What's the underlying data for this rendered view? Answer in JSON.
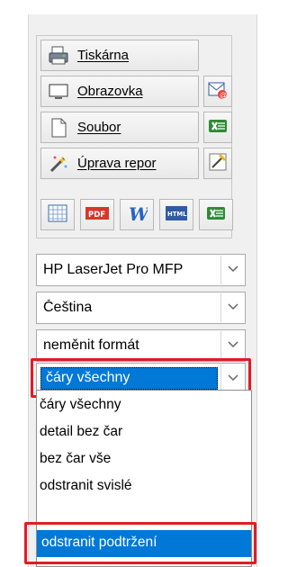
{
  "toolbar": {
    "buttons": [
      {
        "label": "Tiskárna",
        "icon": "printer-icon"
      },
      {
        "label": "Obrazovka",
        "icon": "screen-icon"
      },
      {
        "label": "Soubor",
        "icon": "file-icon"
      },
      {
        "label": "Úprava repor",
        "icon": "wand-icon"
      }
    ],
    "side_icons": [
      "email-icon",
      "excel-icon",
      "edit-report-icon"
    ],
    "export_icons": [
      "calc-icon",
      "pdf-icon",
      "word-icon",
      "html-icon",
      "excel-icon"
    ]
  },
  "selects": [
    {
      "name": "printer-select",
      "value": "HP LaserJet Pro MFP"
    },
    {
      "name": "language-select",
      "value": "Čeština"
    },
    {
      "name": "format-select",
      "value": "neměnit formát"
    },
    {
      "name": "lines-select",
      "value": "čáry všechny"
    }
  ],
  "dropdown": {
    "items": [
      "čáry všechny",
      "detail bez čar",
      "bez čar vše",
      "odstranit svislé",
      "odstranit podtržení"
    ],
    "active_index": 4
  },
  "colors": {
    "selection": "#0078d7",
    "highlight_outline": "#e21b24",
    "panel": "#f0f0f0"
  }
}
